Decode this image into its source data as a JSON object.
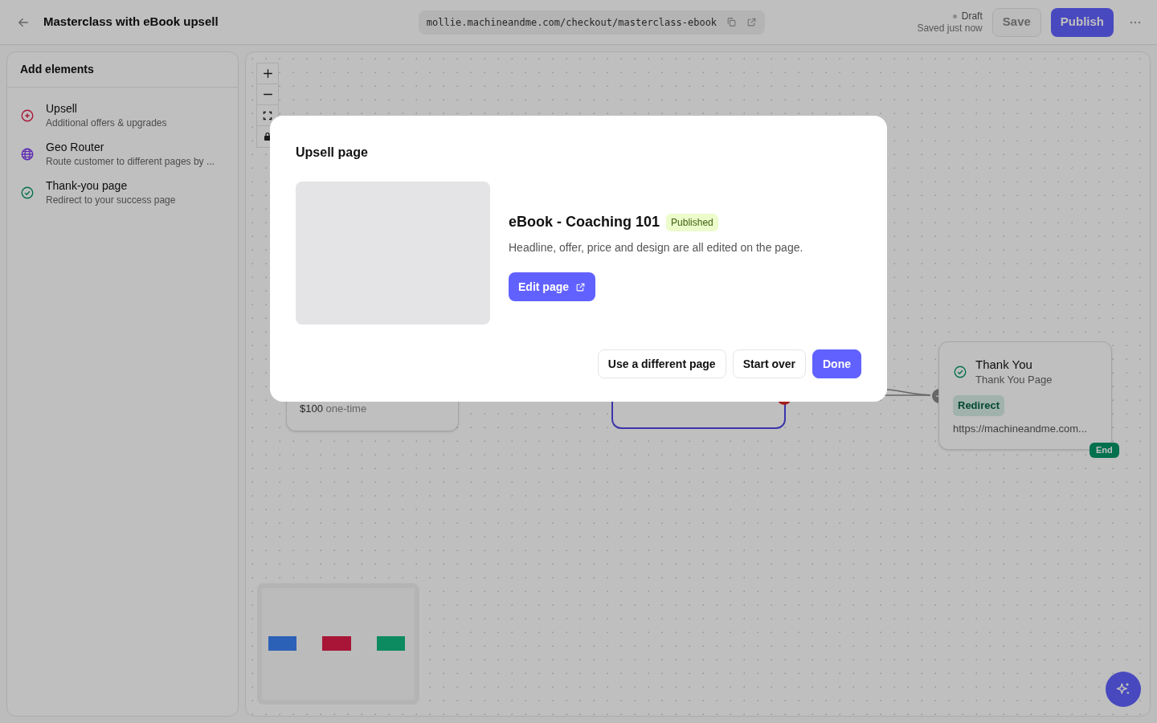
{
  "header": {
    "title": "Masterclass with eBook upsell",
    "url": "mollie.machineandme.com/checkout/masterclass-ebook",
    "status": "Draft",
    "saved": "Saved just now",
    "save": "Save",
    "publish": "Publish"
  },
  "sidebar": {
    "title": "Add elements",
    "items": [
      {
        "kind": "upsell",
        "title": "Upsell",
        "description": "Additional offers & upgrades"
      },
      {
        "kind": "geo_router",
        "title": "Geo Router",
        "description": "Route customer to different pages by ..."
      },
      {
        "kind": "thank_you",
        "title": "Thank-you page",
        "description": "Redirect to your success page"
      }
    ]
  },
  "canvas": {
    "offer_card": {
      "price": "$100",
      "price_note": "one-time"
    },
    "thank_you_card": {
      "title": "Thank You",
      "subtitle": "Thank You Page",
      "tag": "Redirect",
      "url": "https://machineandme.com...",
      "badge": "End"
    }
  },
  "modal": {
    "title": "Upsell page",
    "page": {
      "name": "eBook - Coaching 101",
      "status": "Published",
      "description": "Headline, offer, price and design are all edited on the page."
    },
    "edit_button": "Edit page",
    "buttons": [
      {
        "label": "Use a different page",
        "kind": "secondary"
      },
      {
        "label": "Start over",
        "kind": "secondary"
      },
      {
        "label": "Done",
        "kind": "primary"
      }
    ]
  }
}
